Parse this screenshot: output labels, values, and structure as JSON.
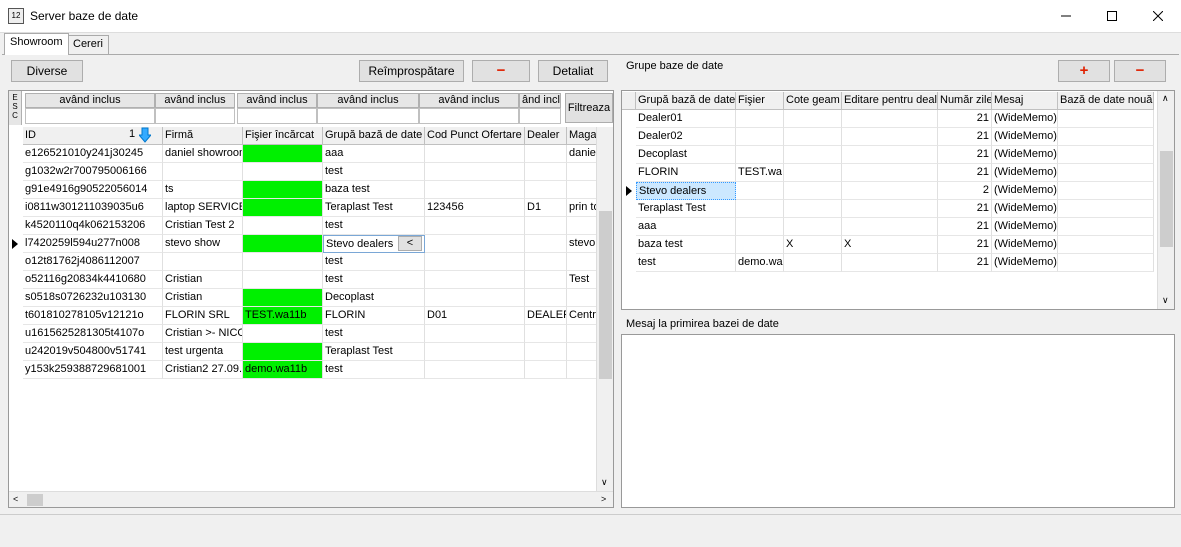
{
  "window": {
    "title": "Server baze de date",
    "icon_label": "12"
  },
  "tabs": [
    {
      "label": "Showroom",
      "active": true
    },
    {
      "label": "Cereri",
      "active": false
    }
  ],
  "left_toolbar": {
    "diverse_label": "Diverse",
    "refresh_label": "Reîmprospătare",
    "minus_label": "−",
    "detail_label": "Detaliat"
  },
  "left_grid": {
    "esc_label": "E S C",
    "filter_label": "Filtreaza",
    "filter_headers": [
      "având inclus",
      "având inclus",
      "având inclus",
      "având inclus",
      "având inclus",
      "ând inclu"
    ],
    "columns": [
      "ID",
      "Firmă",
      "Fişier încărcat",
      "Grupă bază de date",
      "Cod Punct Ofertare",
      "Dealer",
      "Magazi"
    ],
    "sort_indicator": "1",
    "rows": [
      {
        "id": "e126521010y241j30245",
        "firma": "daniel showroom",
        "fisier": "",
        "fisier_green": true,
        "grupa": "aaa",
        "cod": "",
        "dealer": "",
        "magazin": "daniel s"
      },
      {
        "id": "g1032w2r700795006166",
        "firma": "",
        "fisier": "",
        "fisier_green": false,
        "grupa": "test",
        "cod": "",
        "dealer": "",
        "magazin": ""
      },
      {
        "id": "g91e4916g90522056014",
        "firma": "ts",
        "fisier": "",
        "fisier_green": true,
        "grupa": "baza test",
        "cod": "",
        "dealer": "",
        "magazin": ""
      },
      {
        "id": "i0811w301211039035u6",
        "firma": "laptop SERVICE",
        "fisier": "",
        "fisier_green": true,
        "grupa": "Teraplast Test",
        "cod": "123456",
        "dealer": "D1",
        "magazin": "prin toa"
      },
      {
        "id": "k4520110q4k062153206",
        "firma": "Cristian Test 2",
        "fisier": "",
        "fisier_green": false,
        "grupa": "test",
        "cod": "",
        "dealer": "",
        "magazin": ""
      },
      {
        "id": "l7420259l594u277n008",
        "firma": "stevo show",
        "fisier": "",
        "fisier_green": true,
        "grupa": "Stevo dealers",
        "cod": "",
        "dealer": "",
        "magazin": "stevo",
        "current": true
      },
      {
        "id": "o12t81762j4086112007",
        "firma": "",
        "fisier": "",
        "fisier_green": false,
        "grupa": "test",
        "cod": "",
        "dealer": "",
        "magazin": ""
      },
      {
        "id": "o52116g20834k4410680",
        "firma": "Cristian",
        "fisier": "",
        "fisier_green": false,
        "grupa": "test",
        "cod": "",
        "dealer": "",
        "magazin": "Test"
      },
      {
        "id": "s0518s0726232u103130",
        "firma": "Cristian",
        "fisier": "",
        "fisier_green": true,
        "grupa": "Decoplast",
        "cod": "",
        "dealer": "",
        "magazin": ""
      },
      {
        "id": "t601810278105v12121o",
        "firma": "FLORIN SRL",
        "fisier": "TEST.wa11b",
        "fisier_green": true,
        "grupa": "FLORIN",
        "cod": "D01",
        "dealer": "DEALER",
        "magazin": "Central"
      },
      {
        "id": "u1615625281305t4107o",
        "firma": "Cristian >- NICO",
        "fisier": "",
        "fisier_green": false,
        "grupa": "test",
        "cod": "",
        "dealer": "",
        "magazin": ""
      },
      {
        "id": "u242019v504800v51741",
        "firma": "test urgenta",
        "fisier": "",
        "fisier_green": true,
        "grupa": "Teraplast Test",
        "cod": "",
        "dealer": "",
        "magazin": ""
      },
      {
        "id": "y153k259388729681001",
        "firma": "Cristian2 27.09.",
        "fisier": "demo.wa11b",
        "fisier_green": true,
        "grupa": "test",
        "cod": "",
        "dealer": "",
        "magazin": ""
      }
    ],
    "inline_button_label": "<"
  },
  "right_panel": {
    "title": "Grupe baze de date",
    "plus_label": "+",
    "minus_label": "−",
    "columns": [
      "Grupă bază de date",
      "Fişier",
      "Cote geam",
      "Editare pentru deal",
      "Număr zile",
      "Mesaj",
      "Bază de date nouă"
    ],
    "rows": [
      {
        "grupa": "Dealer01",
        "fisier": "",
        "cote": "",
        "editare": "",
        "zile": "21",
        "mesaj": "(WideMemo)"
      },
      {
        "grupa": "Dealer02",
        "fisier": "",
        "cote": "",
        "editare": "",
        "zile": "21",
        "mesaj": "(WideMemo)"
      },
      {
        "grupa": "Decoplast",
        "fisier": "",
        "cote": "",
        "editare": "",
        "zile": "21",
        "mesaj": "(WideMemo)"
      },
      {
        "grupa": "FLORIN",
        "fisier": "TEST.wa",
        "cote": "",
        "editare": "",
        "zile": "21",
        "mesaj": "(WideMemo)"
      },
      {
        "grupa": "Stevo dealers",
        "fisier": "",
        "cote": "",
        "editare": "",
        "zile": "2",
        "mesaj": "(WideMemo)",
        "current": true
      },
      {
        "grupa": "Teraplast Test",
        "fisier": "",
        "cote": "",
        "editare": "",
        "zile": "21",
        "mesaj": "(WideMemo)"
      },
      {
        "grupa": "aaa",
        "fisier": "",
        "cote": "",
        "editare": "",
        "zile": "21",
        "mesaj": "(WideMemo)"
      },
      {
        "grupa": "baza test",
        "fisier": "",
        "cote": "X",
        "editare": "X",
        "zile": "21",
        "mesaj": "(WideMemo)"
      },
      {
        "grupa": "test",
        "fisier": "demo.wa",
        "cote": "",
        "editare": "",
        "zile": "21",
        "mesaj": "(WideMemo)"
      }
    ],
    "message_label": "Mesaj la primirea bazei de date",
    "message_value": ""
  },
  "colors": {
    "green_cell": "#00f000",
    "accent_red": "#e02000",
    "selection": "#cce8ff"
  }
}
